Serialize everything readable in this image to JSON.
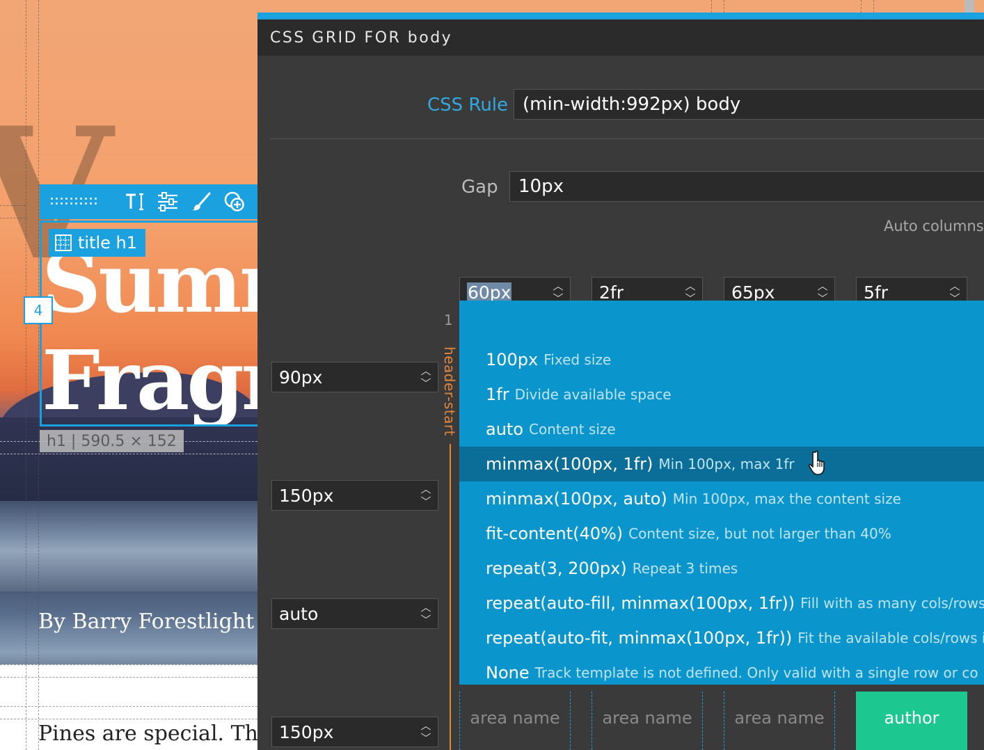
{
  "page": {
    "title_line1": "Summ",
    "title_line2": "Fragr",
    "element_badge": "title h1",
    "element_size": "h1 | 590.5 × 152",
    "column_badge": "4",
    "byline": "By Barry Forestlight",
    "body_text": "Pines are special. They"
  },
  "toolbar": {
    "icons": [
      "drag-grip-icon",
      "text-tool-icon",
      "sliders-icon",
      "brush-icon",
      "add-circle-icon"
    ]
  },
  "panel": {
    "title": "CSS GRID FOR body",
    "css_rule_label": "CSS Rule",
    "css_rule_value": "(min-width:992px) body",
    "gap_label": "Gap",
    "gap_value": "10px",
    "auto_columns_label": "Auto columns",
    "columns": [
      "60px",
      "2fr",
      "65px",
      "5fr"
    ],
    "rows": [
      "90px",
      "150px",
      "auto",
      "150px"
    ],
    "row_index": "1",
    "row_line_name": "header-start",
    "dropdown": [
      {
        "value": "100px",
        "desc": "Fixed size"
      },
      {
        "value": "1fr",
        "desc": "Divide available space"
      },
      {
        "value": "auto",
        "desc": "Content size"
      },
      {
        "value": "minmax(100px, 1fr)",
        "desc": "Min 100px, max 1fr"
      },
      {
        "value": "minmax(100px, auto)",
        "desc": "Min 100px, max the content size"
      },
      {
        "value": "fit-content(40%)",
        "desc": "Content size, but not larger than 40%"
      },
      {
        "value": "repeat(3, 200px)",
        "desc": "Repeat 3 times"
      },
      {
        "value": "repeat(auto-fill, minmax(100px, 1fr))",
        "desc": "Fill with as many cols/rows"
      },
      {
        "value": "repeat(auto-fit, minmax(100px, 1fr))",
        "desc": "Fit the available cols/rows i"
      },
      {
        "value": "None",
        "desc": "Track template is not defined. Only valid with a single row or co"
      }
    ],
    "hovered_index": 3,
    "cells": [
      "area name",
      "area name",
      "area name",
      "author"
    ]
  },
  "colors": {
    "accent": "#1ba0e0",
    "dropdown_bg": "#0b95cd",
    "dropdown_hover": "#0a6e98",
    "row_line": "#e0873f",
    "named_area": "#1cc88f",
    "panel_bg": "#3a3a3a",
    "label_blue": "#34a8e0",
    "label_gray": "#bdbdbd"
  }
}
